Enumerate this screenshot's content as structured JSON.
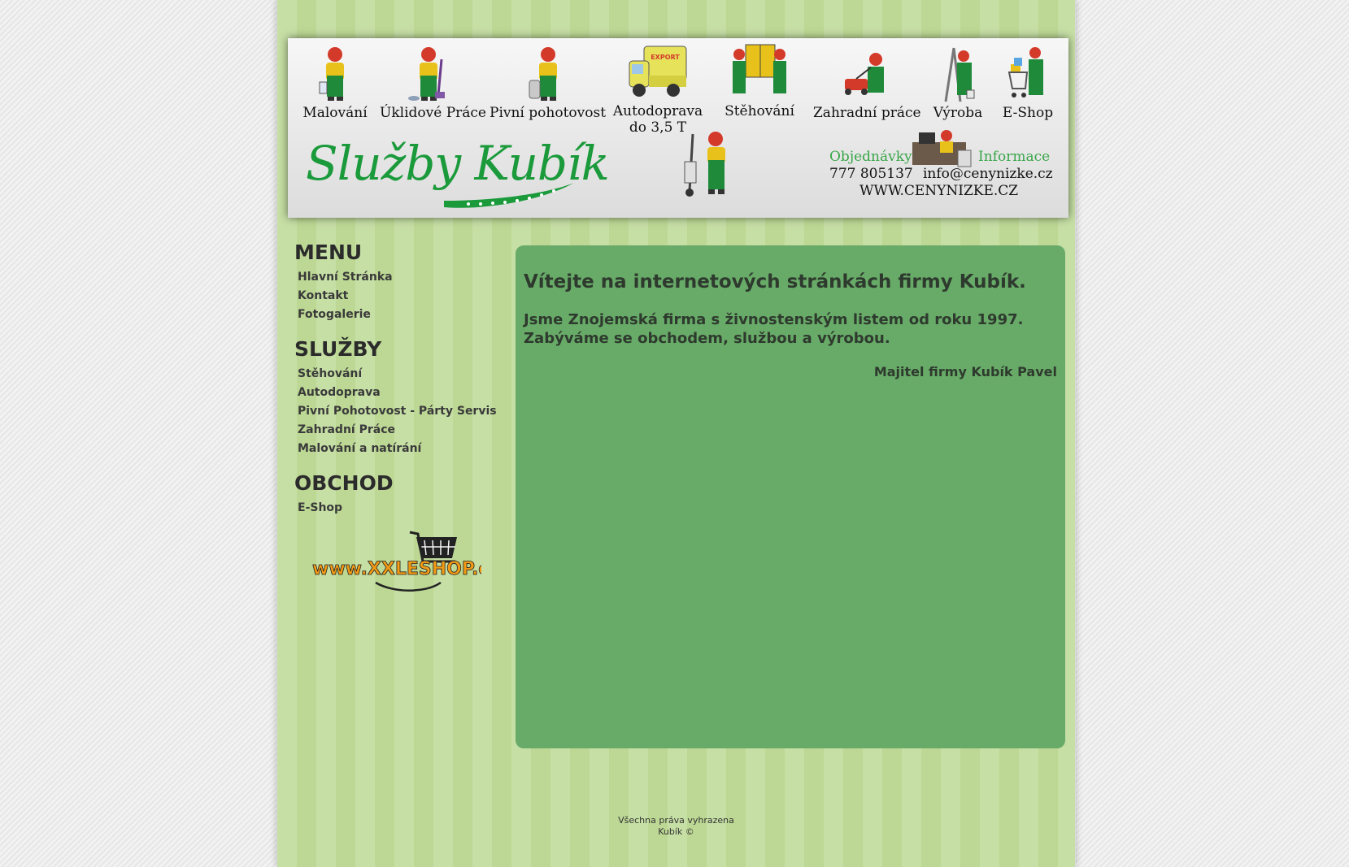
{
  "header": {
    "services": [
      {
        "label": "Malování",
        "icon": "painter-icon"
      },
      {
        "label": "Úklidové Práce",
        "icon": "cleaner-icon"
      },
      {
        "label": "Pivní pohotovost",
        "icon": "beer-keg-icon"
      },
      {
        "label": "Autodoprava",
        "label2": "do 3,5 T",
        "icon": "truck-icon"
      },
      {
        "label": "Stěhování",
        "icon": "movers-icon"
      },
      {
        "label": "Zahradní práce",
        "icon": "lawnmower-icon"
      },
      {
        "label": "Výroba",
        "icon": "ladder-icon"
      },
      {
        "label": "E-Shop",
        "icon": "shopping-cart-icon"
      }
    ],
    "logo_text": "Služby Kubík",
    "orders_label": "Objednávky",
    "info_label": "Informace",
    "phone": "777 805137",
    "email": "info@cenynizke.cz",
    "website": "WWW.CENYNIZKE.CZ"
  },
  "sidebar": {
    "menu": {
      "title": "MENU",
      "items": [
        "Hlavní Stránka",
        "Kontakt",
        "Fotogalerie"
      ]
    },
    "services": {
      "title": "SLUŽBY",
      "items": [
        "Stěhování",
        "Autodoprava",
        "Pivní Pohotovost - Párty Servis",
        "Zahradní Práce",
        "Malování a natírání"
      ]
    },
    "shop": {
      "title": "OBCHOD",
      "items": [
        "E-Shop"
      ]
    },
    "banner_text": "www.XXLESHOP.cz"
  },
  "content": {
    "heading": "Vítejte na internetových stránkách firmy Kubík.",
    "intro_line1": "Jsme Znojemská firma s živnostenským listem od roku 1997.",
    "intro_line2": "Zabýváme se obchodem, službou a výrobou.",
    "owner": "Majitel firmy Kubík Pavel"
  },
  "footer": {
    "rights": "Všechna práva vyhrazena",
    "copyright": "Kubík ©"
  },
  "colors": {
    "content_bg": "#68ab68",
    "logo_green": "#1a9a3a",
    "stripe_light": "#c6dfa5",
    "stripe_dark": "#bcd894"
  }
}
